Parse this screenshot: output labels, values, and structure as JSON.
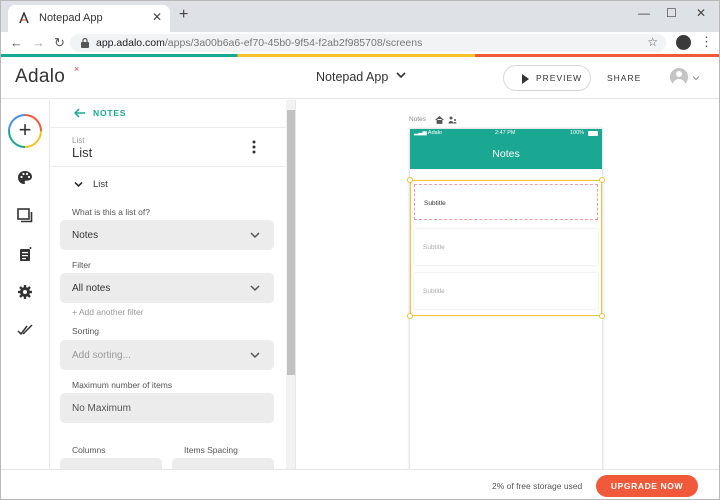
{
  "browser": {
    "tab_title": "Notepad App",
    "new_tab_icon": "plus-icon",
    "url_host": "app.adalo.com",
    "url_path": "/apps/3a00b6a6-ef70-45b0-9f54-f2ab2f985708/screens"
  },
  "header": {
    "logo": "Adalo",
    "app_name": "Notepad App",
    "preview_label": "PREVIEW",
    "share_label": "SHARE"
  },
  "rail": {
    "icons": [
      "add-component-icon",
      "palette-icon",
      "screens-icon",
      "database-icon",
      "settings-icon",
      "publish-icon"
    ]
  },
  "panel": {
    "back_label": "NOTES",
    "component_type": "List",
    "component_name": "List",
    "section_label": "List",
    "list_of_label": "What is this a list of?",
    "list_of_value": "Notes",
    "filter_label": "Filter",
    "filter_value": "All notes",
    "add_filter_label": "+ Add another filter",
    "sorting_label": "Sorting",
    "sorting_placeholder": "Add sorting...",
    "max_items_label": "Maximum number of items",
    "max_items_value": "No Maximum",
    "columns_label": "Columns",
    "spacing_label": "Items Spacing"
  },
  "canvas": {
    "screen_label": "Notes",
    "status_carrier": "Adalo",
    "status_time": "2:47 PM",
    "status_battery": "100%",
    "nav_title": "Notes",
    "list_items": [
      {
        "subtitle": "Subtitle"
      },
      {
        "subtitle": "Subtitle"
      },
      {
        "subtitle": "Subtitle"
      }
    ],
    "selection_color": "#f2c335"
  },
  "footer": {
    "storage_text": "2% of free storage used",
    "upgrade_label": "UPGRADE NOW"
  },
  "colors": {
    "brand_teal": "#1aa892",
    "brand_yellow": "#f5c42b",
    "brand_orange": "#f05a3a"
  }
}
